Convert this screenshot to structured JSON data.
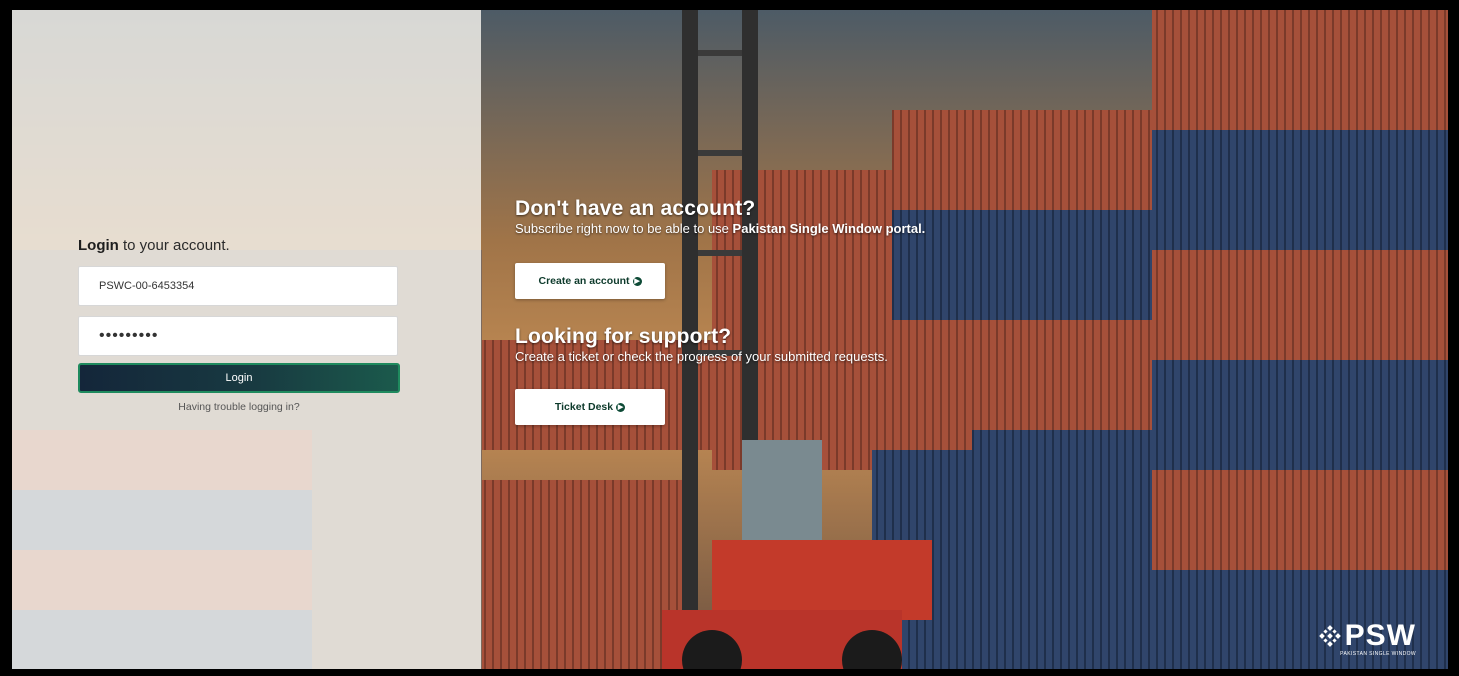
{
  "login": {
    "heading_bold": "Login",
    "heading_rest": "to your account.",
    "username_value": "PSWC-00-6453354",
    "password_value": "•••••••••",
    "login_button": "Login",
    "trouble_link": "Having trouble logging in?"
  },
  "signup": {
    "title": "Don't have an account?",
    "subtitle_text": "Subscribe right now to be able to use",
    "subtitle_bold": "Pakistan Single Window portal.",
    "button": "Create an account"
  },
  "support": {
    "title": "Looking for support?",
    "subtitle": "Create a ticket or check the progress of your submitted requests.",
    "button": "Ticket Desk"
  },
  "logo": {
    "text": "PSW",
    "subtitle": "PAKISTAN SINGLE WINDOW"
  },
  "colors": {
    "login_button_start": "#14263a",
    "login_button_end": "#1b5a4c",
    "accent_green": "#1f8a5e"
  }
}
